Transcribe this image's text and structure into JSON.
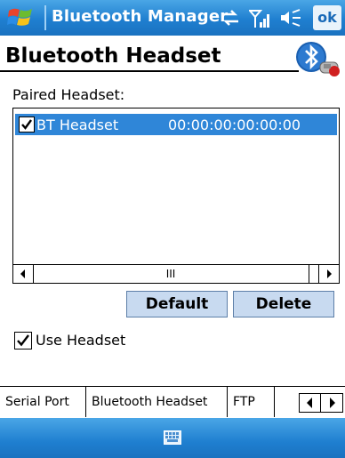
{
  "titlebar": {
    "app_title": "Bluetooth Manager",
    "ok_label": "ok",
    "icons": [
      "windows-start-icon",
      "connectivity-icon",
      "signal-icon",
      "volume-icon"
    ]
  },
  "header": {
    "title": "Bluetooth Headset",
    "badge_icon": "bluetooth-headset-icon"
  },
  "main": {
    "paired_label": "Paired Headset:",
    "list": [
      {
        "checked": true,
        "name": "BT Headset",
        "address": "00:00:00:00:00:00"
      }
    ],
    "scroll_thumb_symbol": "III",
    "buttons": {
      "default": "Default",
      "delete": "Delete"
    },
    "use_headset": {
      "checked": true,
      "label": "Use Headset"
    }
  },
  "tabs": [
    {
      "label": "Serial Port",
      "active": false
    },
    {
      "label": "Bluetooth Headset",
      "active": true
    },
    {
      "label": "FTP",
      "active": false
    }
  ],
  "bottombar": {
    "icon": "keyboard-icon"
  },
  "colors": {
    "titlebar": "#1f7fd0",
    "selection": "#2f86d8",
    "button": "#c8daf0"
  }
}
